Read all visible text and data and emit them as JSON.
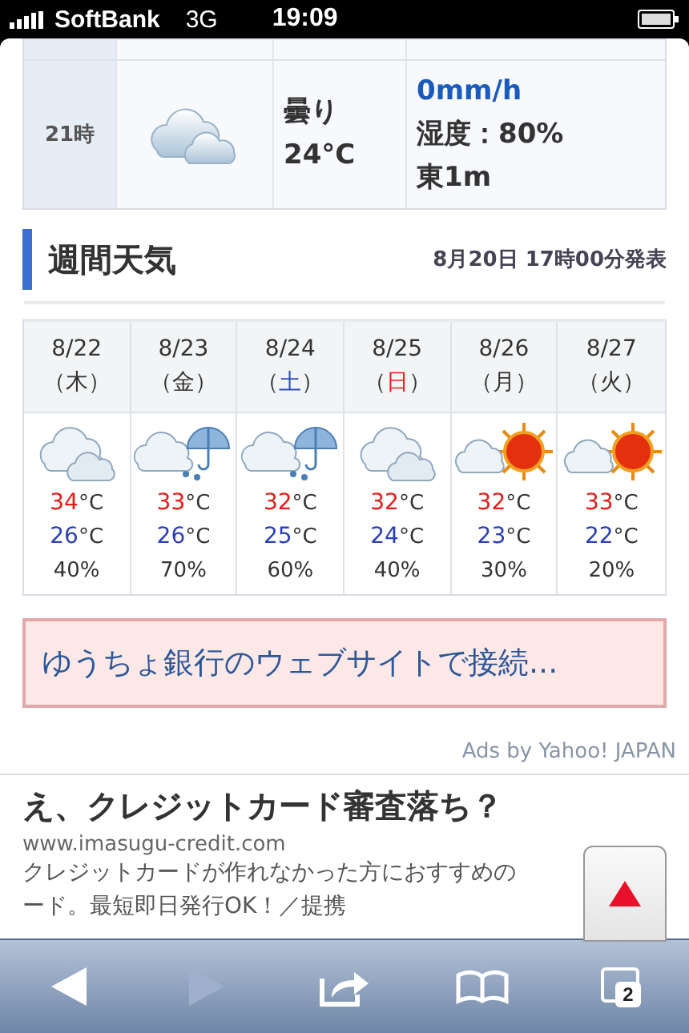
{
  "status_bar": {
    "carrier": "SoftBank",
    "network": "3G",
    "time": "19:09"
  },
  "hourly": [
    {
      "time": "21時",
      "kind": "cloudy",
      "weather": "曇り",
      "temp": "24°C",
      "rain": "0mm/h",
      "humidity": "湿度：80%",
      "wind": "東1m"
    }
  ],
  "weekly": {
    "title": "週間天気",
    "issued": "8月20日 17時00分発表",
    "days": [
      {
        "date": "8/22",
        "open": "（",
        "weekday": "木",
        "close": "）",
        "color": "#333333",
        "kind": "cloudy",
        "high": {
          "value": "34",
          "unit": "°C"
        },
        "low": {
          "value": "26",
          "unit": "°C"
        },
        "chance": "40%"
      },
      {
        "date": "8/23",
        "open": "（",
        "weekday": "金",
        "close": "）",
        "color": "#333333",
        "kind": "rain",
        "high": {
          "value": "33",
          "unit": "°C"
        },
        "low": {
          "value": "26",
          "unit": "°C"
        },
        "chance": "70%"
      },
      {
        "date": "8/24",
        "open": "（",
        "weekday": "土",
        "close": "）",
        "color": "#2b4fc4",
        "kind": "rain",
        "high": {
          "value": "32",
          "unit": "°C"
        },
        "low": {
          "value": "25",
          "unit": "°C"
        },
        "chance": "60%"
      },
      {
        "date": "8/25",
        "open": "（",
        "weekday": "日",
        "close": "）",
        "color": "#e0201b",
        "kind": "cloudy",
        "high": {
          "value": "32",
          "unit": "°C"
        },
        "low": {
          "value": "24",
          "unit": "°C"
        },
        "chance": "40%"
      },
      {
        "date": "8/26",
        "open": "（",
        "weekday": "月",
        "close": "）",
        "color": "#333333",
        "kind": "sun",
        "high": {
          "value": "32",
          "unit": "°C"
        },
        "low": {
          "value": "23",
          "unit": "°C"
        },
        "chance": "30%"
      },
      {
        "date": "8/27",
        "open": "（",
        "weekday": "火",
        "close": "）",
        "color": "#333333",
        "kind": "sun",
        "high": {
          "value": "33",
          "unit": "°C"
        },
        "low": {
          "value": "22",
          "unit": "°C"
        },
        "chance": "20%"
      }
    ]
  },
  "banner": {
    "text": "ゆうちょ銀行のウェブサイトで接続..."
  },
  "ads": {
    "credit": "Ads by Yahoo! JAPAN",
    "title": "え、クレジットカード審査落ち？",
    "url": "www.imasugu-credit.com",
    "lines": [
      "クレジットカードが作れなかった方におすすめの",
      "ード。最短即日発行OK！／提携"
    ]
  },
  "toolbar": {
    "back_disabled": false,
    "forward_disabled": true,
    "tab_count": "2"
  }
}
